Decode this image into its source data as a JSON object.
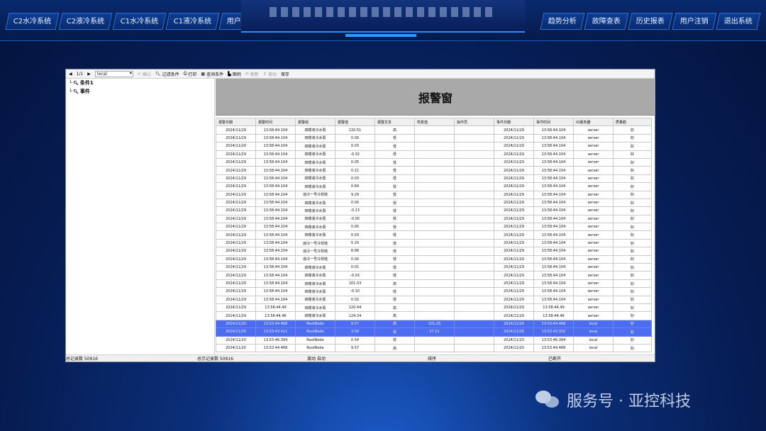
{
  "nav": {
    "left": [
      "C2水冷系统",
      "C2液冷系统",
      "C1水冷系统",
      "C1液冷系统",
      "用户管理"
    ],
    "right": [
      "趋势分析",
      "故障查表",
      "历史报表",
      "用户注销",
      "退出系统"
    ]
  },
  "toolbar": {
    "prev": "◀",
    "page": "1/1",
    "next": "▶",
    "server_select": "local",
    "confirm": "确认",
    "filter_condition": "过滤条件",
    "print": "打印",
    "show_condition": "查询条件",
    "legend": "图例",
    "refresh": "刷新",
    "scroll": "滚动",
    "save": "保存"
  },
  "tree": [
    "条件1",
    "事件"
  ],
  "alarm_title": "报警窗",
  "table": {
    "headers": [
      "报警日期",
      "报警时间",
      "报警组",
      "报警值",
      "报警文本",
      "恢复值",
      "操作员",
      "事件日期",
      "事件时间",
      "IO服务器",
      "质量戳"
    ],
    "rows": [
      [
        "2024/11/29",
        "13:58:44.104",
        "四楼液冷水泵",
        "132.51",
        "高",
        "",
        "",
        "2024/11/29",
        "13:58:44.104",
        "server",
        "好"
      ],
      [
        "2024/11/29",
        "13:58:44.104",
        "四楼液冷水泵",
        "0.00",
        "低",
        "",
        "",
        "2024/11/29",
        "13:58:44.104",
        "server",
        "好"
      ],
      [
        "2024/11/29",
        "13:58:44.104",
        "四楼液冷水泵",
        "0.03",
        "低",
        "",
        "",
        "2024/11/29",
        "13:58:44.104",
        "server",
        "好"
      ],
      [
        "2024/11/29",
        "13:58:44.104",
        "四楼液冷水泵",
        "-0.32",
        "低",
        "",
        "",
        "2024/11/29",
        "13:58:44.104",
        "server",
        "好"
      ],
      [
        "2024/11/29",
        "13:58:44.104",
        "四楼液冷水泵",
        "0.05",
        "低",
        "",
        "",
        "2024/11/29",
        "13:58:44.104",
        "server",
        "好"
      ],
      [
        "2024/11/29",
        "13:58:44.104",
        "四楼液冷水泵",
        "0.11",
        "低",
        "",
        "",
        "2024/11/29",
        "13:58:44.104",
        "server",
        "好"
      ],
      [
        "2024/11/29",
        "13:58:44.104",
        "四楼液冷水泵",
        "0.03",
        "低",
        "",
        "",
        "2024/11/29",
        "13:58:44.104",
        "server",
        "好"
      ],
      [
        "2024/11/29",
        "13:58:44.104",
        "四楼液冷水泵",
        "0.64",
        "低",
        "",
        "",
        "2024/11/29",
        "13:58:44.104",
        "server",
        "好"
      ],
      [
        "2024/11/29",
        "13:58:44.104",
        "液冷一号冷却塔",
        "9.29",
        "低",
        "",
        "",
        "2024/11/29",
        "13:58:44.104",
        "server",
        "好"
      ],
      [
        "2024/11/29",
        "13:58:44.104",
        "四楼液冷水泵",
        "0.00",
        "低",
        "",
        "",
        "2024/11/29",
        "13:58:44.104",
        "server",
        "好"
      ],
      [
        "2024/11/29",
        "13:58:44.104",
        "四楼液冷水泵",
        "-0.13",
        "低",
        "",
        "",
        "2024/11/29",
        "13:58:44.104",
        "server",
        "好"
      ],
      [
        "2024/11/29",
        "13:58:44.104",
        "四楼液冷水泵",
        "-0.05",
        "低",
        "",
        "",
        "2024/11/29",
        "13:58:44.104",
        "server",
        "好"
      ],
      [
        "2024/11/29",
        "13:58:44.104",
        "四楼液冷水泵",
        "0.00",
        "低",
        "",
        "",
        "2024/11/29",
        "13:58:44.104",
        "server",
        "好"
      ],
      [
        "2024/11/29",
        "13:58:44.104",
        "四楼液冷水泵",
        "0.03",
        "低",
        "",
        "",
        "2024/11/29",
        "13:58:44.104",
        "server",
        "好"
      ],
      [
        "2024/11/29",
        "13:58:44.104",
        "液冷一号冷却塔",
        "5.20",
        "低",
        "",
        "",
        "2024/11/29",
        "13:58:44.104",
        "server",
        "好"
      ],
      [
        "2024/11/29",
        "13:58:44.104",
        "液冷一号冷却塔",
        "8.68",
        "低",
        "",
        "",
        "2024/11/29",
        "13:58:44.104",
        "server",
        "好"
      ],
      [
        "2024/11/29",
        "13:58:44.104",
        "液冷一号冷却塔",
        "0.00",
        "低",
        "",
        "",
        "2024/11/29",
        "13:58:44.104",
        "server",
        "好"
      ],
      [
        "2024/11/29",
        "13:58:44.104",
        "四楼液冷水泵",
        "0.01",
        "低",
        "",
        "",
        "2024/11/29",
        "13:58:44.104",
        "server",
        "好"
      ],
      [
        "2024/11/29",
        "13:58:44.104",
        "四楼液冷水泵",
        "-0.03",
        "低",
        "",
        "",
        "2024/11/29",
        "13:58:44.104",
        "server",
        "好"
      ],
      [
        "2024/11/29",
        "13:58:44.104",
        "四楼液冷水泵",
        "101.03",
        "高",
        "",
        "",
        "2024/11/29",
        "13:58:44.104",
        "server",
        "好"
      ],
      [
        "2024/11/29",
        "13:58:44.104",
        "四楼液冷水泵",
        "-0.10",
        "低",
        "",
        "",
        "2024/11/29",
        "13:58:44.104",
        "server",
        "好"
      ],
      [
        "2024/11/29",
        "13:58:44.104",
        "四楼液冷水泵",
        "0.02",
        "低",
        "",
        "",
        "2024/11/29",
        "13:58:44.104",
        "server",
        "好"
      ],
      [
        "2024/11/29",
        "13:58:44.49",
        "四楼液冷水泵",
        "120.44",
        "高",
        "",
        "",
        "2024/11/29",
        "13:58:44.49",
        "server",
        "好"
      ],
      [
        "2024/11/29",
        "13:58:44.46",
        "四楼液冷水泵",
        "124.34",
        "高",
        "",
        "",
        "2024/11/29",
        "13:58:44.46",
        "server",
        "好"
      ],
      [
        "2024/11/20",
        "13:53:44.468",
        "RootNode",
        "9.57",
        "高",
        "101.25",
        "",
        "2024/11/20",
        "13:53:44.468",
        "local",
        "好"
      ],
      [
        "2024/11/20",
        "13:53:43.411",
        "RootNode",
        "3.00",
        "低",
        "17.21",
        "",
        "2024/11/20",
        "13:53:43.310",
        "local",
        "好"
      ],
      [
        "2024/11/20",
        "13:53:46.394",
        "RootNode",
        "0.54",
        "低",
        "",
        "",
        "2024/11/20",
        "13:53:46.394",
        "local",
        "好"
      ],
      [
        "2024/11/20",
        "13:53:44.468",
        "RootNode",
        "9.57",
        "高",
        "",
        "",
        "2024/11/20",
        "13:53:44.468",
        "local",
        "好"
      ]
    ],
    "selected_rows": [
      24,
      25
    ]
  },
  "status": {
    "total_records": "总记录数 50916",
    "current_records": "总示记录数 50916",
    "scroll": "滚动 自动",
    "sort": "排序",
    "connection": "已断开"
  },
  "watermark": "服务号 · 亚控科技",
  "colors": {
    "selected_row": "#4d6df0",
    "banner": "#a9a9a9",
    "nav_border": "#2a74d6"
  }
}
